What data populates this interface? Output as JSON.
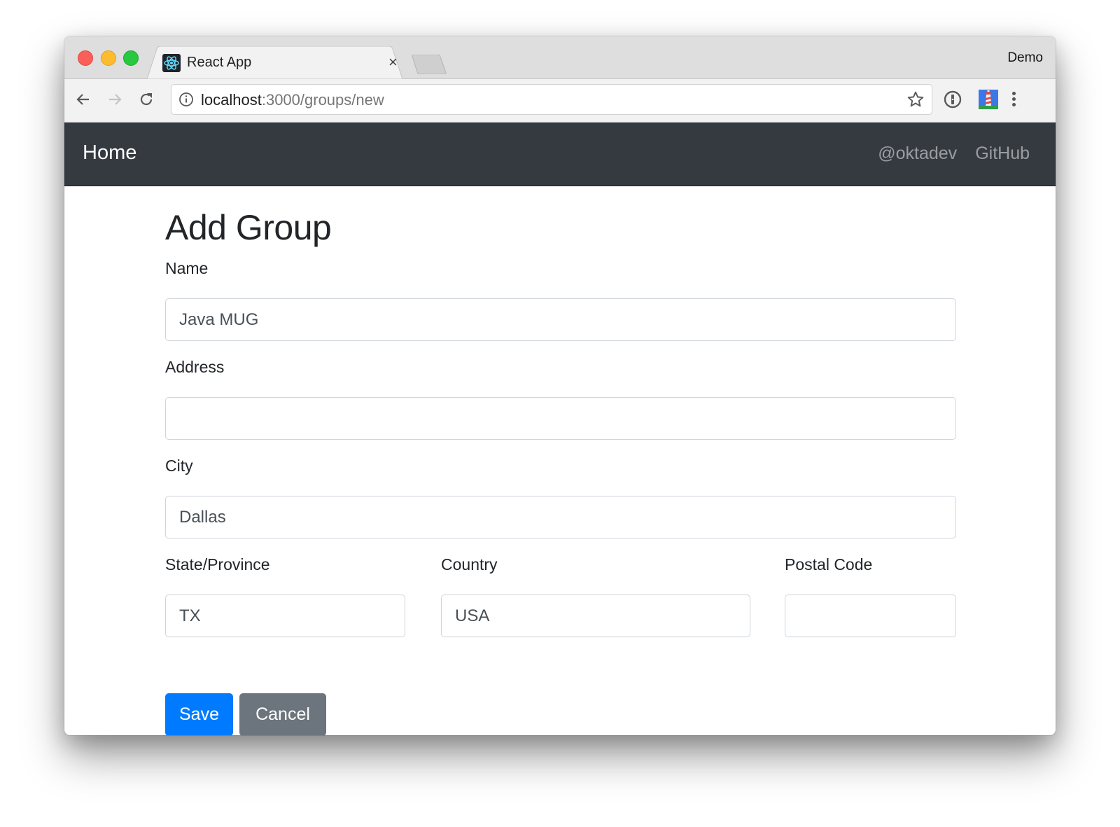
{
  "browser": {
    "tab": {
      "title": "React App",
      "favicon": "react-logo-icon",
      "close": "×"
    },
    "profile_name": "Demo",
    "omnibox": {
      "host": "localhost",
      "rest": ":3000/groups/new"
    },
    "icons": {
      "back": "arrow-left-icon",
      "forward": "arrow-right-icon",
      "reload": "reload-icon",
      "info": "info-icon",
      "bookmark": "star-icon",
      "extension1": "password-manager-icon",
      "extension2": "lighthouse-icon",
      "menu": "more-vert-icon"
    },
    "colors": {
      "close": "#fc5f57",
      "minimize": "#fdbc2f",
      "zoom": "#28c840"
    }
  },
  "navbar": {
    "brand": "Home",
    "links": [
      "@oktadev",
      "GitHub"
    ],
    "background": "#343a40"
  },
  "page": {
    "title": "Add Group",
    "fields": {
      "name": {
        "label": "Name",
        "value": "Java MUG"
      },
      "address": {
        "label": "Address",
        "value": ""
      },
      "city": {
        "label": "City",
        "value": "Dallas"
      },
      "state": {
        "label": "State/Province",
        "value": "TX"
      },
      "country": {
        "label": "Country",
        "value": "USA"
      },
      "postal": {
        "label": "Postal Code",
        "value": ""
      }
    },
    "buttons": {
      "save": {
        "label": "Save",
        "color": "#007bff"
      },
      "cancel": {
        "label": "Cancel",
        "color": "#6c757d"
      }
    }
  }
}
